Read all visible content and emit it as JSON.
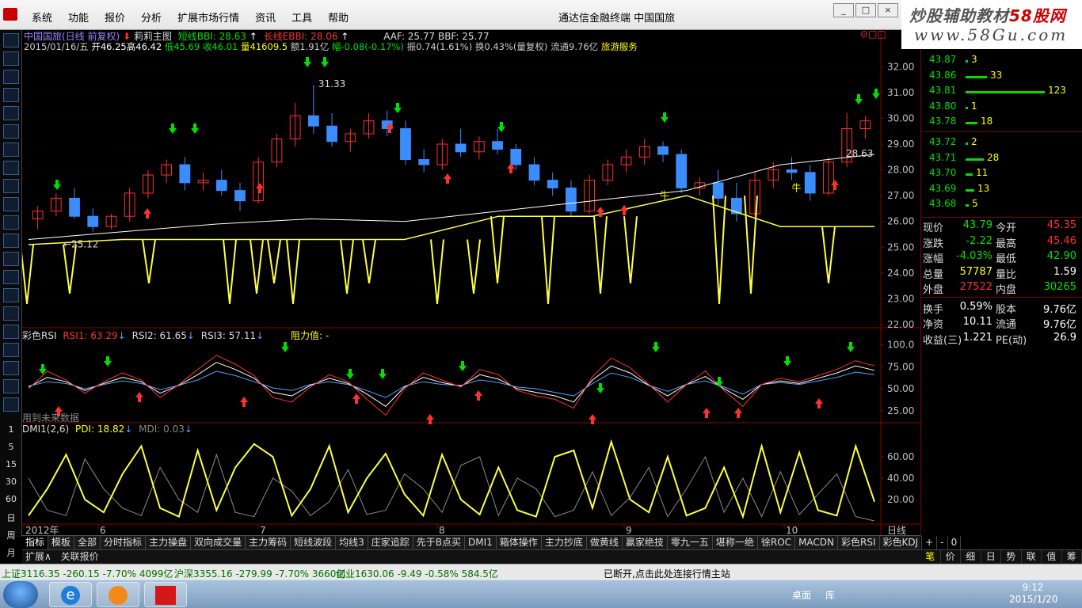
{
  "menu": {
    "items": [
      "系统",
      "功能",
      "报价",
      "分析",
      "扩展市场行情",
      "资讯",
      "工具",
      "帮助"
    ],
    "center_title": "通达信金融终端  中国国旅",
    "watermark_line1": "炒股辅助教材",
    "watermark_brand": "58股网",
    "watermark_line2": "www.58Gu.com"
  },
  "main_chart": {
    "header_line1": {
      "symbol": "中国国旅(日线 前复权)",
      "indicator": "莉莉主图",
      "short_bbi": "短线BBI: 28.63",
      "long_bbi": "长线EBBI: 28.06",
      "aaf": "AAF: 25.77  BBF: 25.77"
    },
    "header_line2": {
      "date": "2015/01/16/五",
      "open": "开46.25",
      "high": "高46.42",
      "low": "低45.69",
      "close": "收46.01",
      "volume": "量41609.5",
      "amount": "额1.91亿",
      "change": "幅-0.08(-0.17%)",
      "amp": "振0.74(1.61%)",
      "turn": "换0.43%(量复权)",
      "float": "流通9.76亿",
      "sector": "旅游服务"
    },
    "annotations": {
      "peak": "31.33",
      "trough": "←25.12",
      "right_label": "28.63",
      "niu1": "牛",
      "niu2": "牛"
    },
    "y_ticks": [
      "32.00",
      "31.00",
      "30.00",
      "29.00",
      "28.00",
      "27.00",
      "26.00",
      "25.00",
      "24.00",
      "23.00",
      "22.00"
    ]
  },
  "rsi_panel": {
    "title": "彩色RSI",
    "rsi1": "RSI1: 63.29",
    "rsi2": "RSI2: 61.65",
    "rsi3": "RSI3: 57.11",
    "resist": "阻力值: -",
    "footnote": "用到未来数据",
    "y_ticks": [
      "100.0",
      "75.00",
      "50.00",
      "25.00"
    ]
  },
  "dmi_panel": {
    "title": "DMI1(2,6)",
    "pdi": "PDI: 18.82",
    "mdi": "MDI: 0.03",
    "y_ticks": [
      "60.00",
      "40.00",
      "20.00"
    ]
  },
  "x_axis": {
    "labels": [
      "2012年",
      "6",
      "7",
      "8",
      "9",
      "10"
    ],
    "period": "日线"
  },
  "left_numbers": [
    "1",
    "5",
    "15",
    "30",
    "60",
    "日",
    "周",
    "月"
  ],
  "order_book": {
    "asks": [
      {
        "price": "43.87",
        "qty": "3"
      },
      {
        "price": "43.86",
        "qty": "33"
      },
      {
        "price": "43.81",
        "qty": "123"
      },
      {
        "price": "43.80",
        "qty": "1"
      },
      {
        "price": "43.78",
        "qty": "18"
      }
    ],
    "bids": [
      {
        "price": "43.72",
        "qty": "2"
      },
      {
        "price": "43.71",
        "qty": "28"
      },
      {
        "price": "43.70",
        "qty": "11"
      },
      {
        "price": "43.69",
        "qty": "13"
      },
      {
        "price": "43.68",
        "qty": "5"
      }
    ]
  },
  "quote": [
    {
      "l1": "现价",
      "v1": "43.79",
      "l2": "今开",
      "v2": "45.35"
    },
    {
      "l1": "涨跌",
      "v1": "-2.22",
      "l2": "最高",
      "v2": "45.46"
    },
    {
      "l1": "涨幅",
      "v1": "-4.03%",
      "l2": "最低",
      "v2": "42.90"
    },
    {
      "l1": "总量",
      "v1": "57787",
      "l2": "量比",
      "v2": "1.59"
    },
    {
      "l1": "外盘",
      "v1": "27522",
      "l2": "内盘",
      "v2": "30265"
    },
    {
      "l1": "换手",
      "v1": "0.59%",
      "l2": "股本",
      "v2": "9.76亿"
    },
    {
      "l1": "净资",
      "v1": "10.11",
      "l2": "流通",
      "v2": "9.76亿"
    },
    {
      "l1": "收益(三)",
      "v1": "1.221",
      "l2": "PE(动)",
      "v2": "26.9"
    }
  ],
  "tabs": [
    "指标",
    "模板",
    "全部",
    "分时指标",
    "主力操盘",
    "双向成交量",
    "主力筹码",
    "短线波段",
    "均线3",
    "庄家追踪",
    "先于B点买",
    "DMI1",
    "箱体操作",
    "主力抄底",
    "做黄线",
    "赢家绝技",
    "零九一五",
    "堪称一绝",
    "徐ROC",
    "MACDN",
    "彩色RSI",
    "彩色KDJ"
  ],
  "tab_controls": [
    "+",
    "-",
    "0"
  ],
  "expand": [
    "扩展∧",
    "关联报价"
  ],
  "right_tabs": [
    "笔",
    "价",
    "细",
    "日",
    "势",
    "联",
    "值",
    "筹"
  ],
  "status": {
    "sh": "上证3116.35 -260.15 -7.70% 4099亿",
    "hs": "沪深3355.16 -279.99 -7.70% 3660亿",
    "cy": "创业1630.06 -9.49 -0.58% 584.5亿",
    "conn": "已断开,点击此处连接行情主站"
  },
  "taskbar": {
    "desktop": "桌面",
    "lib": "库",
    "time": "9:12",
    "date": "2015/1/20"
  },
  "chart_data": [
    {
      "type": "candlestick",
      "title": "中国国旅(日线 前复权)",
      "ylim": [
        22,
        32.5
      ],
      "x_labels": [
        "2012年",
        "6",
        "7",
        "8",
        "9",
        "10"
      ],
      "series": [
        {
          "name": "short_bbi",
          "values": [
            25.3,
            25.6,
            25.9,
            26.1,
            26.0,
            26.4,
            26.8,
            27.2,
            28.2,
            28.6
          ]
        },
        {
          "name": "AAF",
          "values": [
            25.1,
            25.3,
            25.3,
            25.3,
            25.3,
            26.2,
            26.2,
            27.0,
            25.8,
            25.8
          ]
        }
      ],
      "candles_ohlc": [
        [
          26.1,
          26.6,
          25.7,
          26.4
        ],
        [
          26.4,
          27.1,
          26.2,
          26.9
        ],
        [
          26.9,
          27.3,
          26.1,
          26.2
        ],
        [
          26.2,
          26.5,
          25.6,
          25.8
        ],
        [
          25.8,
          26.3,
          25.7,
          26.2
        ],
        [
          26.2,
          27.3,
          26.0,
          27.1
        ],
        [
          27.1,
          28.0,
          26.9,
          27.8
        ],
        [
          27.8,
          28.4,
          27.5,
          28.2
        ],
        [
          28.2,
          28.5,
          27.2,
          27.5
        ],
        [
          27.5,
          27.9,
          27.2,
          27.6
        ],
        [
          27.6,
          28.0,
          27.0,
          27.2
        ],
        [
          27.2,
          27.5,
          26.4,
          26.8
        ],
        [
          26.8,
          28.5,
          26.7,
          28.3
        ],
        [
          28.3,
          29.4,
          28.1,
          29.2
        ],
        [
          29.2,
          30.6,
          28.9,
          30.1
        ],
        [
          30.1,
          31.3,
          29.4,
          29.7
        ],
        [
          29.7,
          30.2,
          28.9,
          29.1
        ],
        [
          29.1,
          29.6,
          28.7,
          29.4
        ],
        [
          29.4,
          30.2,
          29.2,
          29.9
        ],
        [
          29.9,
          30.3,
          29.3,
          29.6
        ],
        [
          29.6,
          29.9,
          28.2,
          28.4
        ],
        [
          28.4,
          28.8,
          27.9,
          28.2
        ],
        [
          28.2,
          29.2,
          28.0,
          29.0
        ],
        [
          29.0,
          29.6,
          28.5,
          28.7
        ],
        [
          28.7,
          29.3,
          28.4,
          29.1
        ],
        [
          29.1,
          29.6,
          28.6,
          28.8
        ],
        [
          28.8,
          29.0,
          28.0,
          28.2
        ],
        [
          28.2,
          28.5,
          27.4,
          27.6
        ],
        [
          27.6,
          27.9,
          27.0,
          27.3
        ],
        [
          27.3,
          27.6,
          26.2,
          26.4
        ],
        [
          26.4,
          27.8,
          26.3,
          27.6
        ],
        [
          27.6,
          28.4,
          27.4,
          28.2
        ],
        [
          28.2,
          28.8,
          27.9,
          28.5
        ],
        [
          28.5,
          29.2,
          28.2,
          28.9
        ],
        [
          28.9,
          29.1,
          28.3,
          28.6
        ],
        [
          28.6,
          28.8,
          27.1,
          27.3
        ],
        [
          27.3,
          27.7,
          27.0,
          27.5
        ],
        [
          27.5,
          28.0,
          26.6,
          26.9
        ],
        [
          26.9,
          27.5,
          26.0,
          26.3
        ],
        [
          26.3,
          27.9,
          26.2,
          27.6
        ],
        [
          27.6,
          28.3,
          27.3,
          28.0
        ],
        [
          28.0,
          28.5,
          27.6,
          27.9
        ],
        [
          27.9,
          28.2,
          26.8,
          27.1
        ],
        [
          27.1,
          28.5,
          27.0,
          28.3
        ],
        [
          28.3,
          30.2,
          28.1,
          29.6
        ],
        [
          29.6,
          30.1,
          29.2,
          29.9
        ]
      ]
    },
    {
      "type": "line",
      "title": "彩色RSI",
      "ylim": [
        15,
        105
      ],
      "series": [
        {
          "name": "RSI1",
          "values": [
            50,
            70,
            60,
            45,
            58,
            68,
            60,
            40,
            55,
            72,
            88,
            78,
            65,
            40,
            35,
            52,
            66,
            58,
            38,
            20,
            50,
            68,
            60,
            52,
            72,
            66,
            48,
            42,
            38,
            28,
            64,
            85,
            74,
            55,
            35,
            55,
            70,
            48,
            30,
            55,
            62,
            58,
            65,
            72,
            82,
            76
          ]
        },
        {
          "name": "RSI2",
          "values": [
            52,
            63,
            58,
            48,
            56,
            63,
            58,
            45,
            54,
            66,
            80,
            72,
            62,
            46,
            42,
            54,
            62,
            56,
            44,
            30,
            52,
            63,
            57,
            53,
            66,
            61,
            50,
            46,
            42,
            35,
            60,
            76,
            68,
            54,
            42,
            55,
            64,
            50,
            38,
            55,
            59,
            56,
            62,
            68,
            76,
            71
          ]
        },
        {
          "name": "RSI3",
          "values": [
            53,
            58,
            56,
            50,
            55,
            59,
            56,
            49,
            54,
            60,
            70,
            65,
            58,
            51,
            48,
            55,
            58,
            55,
            48,
            40,
            53,
            58,
            55,
            54,
            60,
            57,
            52,
            50,
            46,
            42,
            56,
            68,
            63,
            54,
            47,
            55,
            59,
            52,
            44,
            55,
            57,
            55,
            59,
            63,
            69,
            66
          ]
        }
      ]
    },
    {
      "type": "line",
      "title": "DMI1(2,6)",
      "ylim": [
        0,
        80
      ],
      "series": [
        {
          "name": "PDI",
          "values": [
            5,
            30,
            62,
            20,
            8,
            44,
            70,
            12,
            4,
            66,
            10,
            50,
            72,
            60,
            5,
            30,
            70,
            8,
            40,
            63,
            25,
            5,
            62,
            20,
            6,
            50,
            10,
            4,
            60,
            66,
            12,
            74,
            20,
            8,
            60,
            5,
            12,
            50,
            4,
            70,
            8,
            64,
            10,
            5,
            70,
            18
          ]
        },
        {
          "name": "MDI",
          "values": [
            40,
            10,
            5,
            58,
            30,
            12,
            5,
            50,
            20,
            8,
            62,
            8,
            4,
            40,
            28,
            5,
            18,
            48,
            6,
            10,
            44,
            30,
            8,
            52,
            60,
            5,
            40,
            30,
            4,
            10,
            46,
            5,
            22,
            50,
            4,
            30,
            60,
            8,
            40,
            4,
            46,
            6,
            25,
            44,
            4,
            0
          ]
        }
      ]
    }
  ]
}
